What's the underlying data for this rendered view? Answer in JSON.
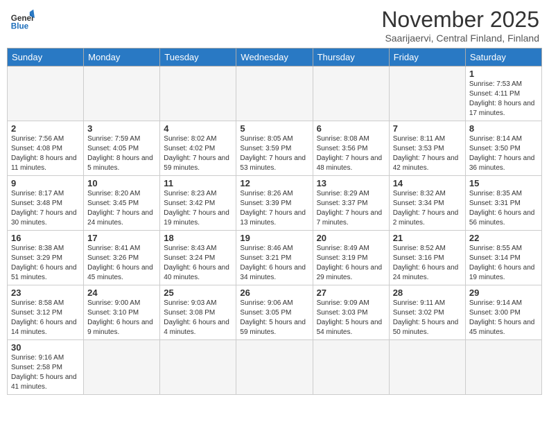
{
  "header": {
    "logo_general": "General",
    "logo_blue": "Blue",
    "month_title": "November 2025",
    "subtitle": "Saarijaervi, Central Finland, Finland"
  },
  "weekdays": [
    "Sunday",
    "Monday",
    "Tuesday",
    "Wednesday",
    "Thursday",
    "Friday",
    "Saturday"
  ],
  "weeks": [
    [
      {
        "day": "",
        "info": "",
        "empty": true
      },
      {
        "day": "",
        "info": "",
        "empty": true
      },
      {
        "day": "",
        "info": "",
        "empty": true
      },
      {
        "day": "",
        "info": "",
        "empty": true
      },
      {
        "day": "",
        "info": "",
        "empty": true
      },
      {
        "day": "",
        "info": "",
        "empty": true
      },
      {
        "day": "1",
        "info": "Sunrise: 7:53 AM\nSunset: 4:11 PM\nDaylight: 8 hours\nand 17 minutes."
      }
    ],
    [
      {
        "day": "2",
        "info": "Sunrise: 7:56 AM\nSunset: 4:08 PM\nDaylight: 8 hours\nand 11 minutes."
      },
      {
        "day": "3",
        "info": "Sunrise: 7:59 AM\nSunset: 4:05 PM\nDaylight: 8 hours\nand 5 minutes."
      },
      {
        "day": "4",
        "info": "Sunrise: 8:02 AM\nSunset: 4:02 PM\nDaylight: 7 hours\nand 59 minutes."
      },
      {
        "day": "5",
        "info": "Sunrise: 8:05 AM\nSunset: 3:59 PM\nDaylight: 7 hours\nand 53 minutes."
      },
      {
        "day": "6",
        "info": "Sunrise: 8:08 AM\nSunset: 3:56 PM\nDaylight: 7 hours\nand 48 minutes."
      },
      {
        "day": "7",
        "info": "Sunrise: 8:11 AM\nSunset: 3:53 PM\nDaylight: 7 hours\nand 42 minutes."
      },
      {
        "day": "8",
        "info": "Sunrise: 8:14 AM\nSunset: 3:50 PM\nDaylight: 7 hours\nand 36 minutes."
      }
    ],
    [
      {
        "day": "9",
        "info": "Sunrise: 8:17 AM\nSunset: 3:48 PM\nDaylight: 7 hours\nand 30 minutes."
      },
      {
        "day": "10",
        "info": "Sunrise: 8:20 AM\nSunset: 3:45 PM\nDaylight: 7 hours\nand 24 minutes."
      },
      {
        "day": "11",
        "info": "Sunrise: 8:23 AM\nSunset: 3:42 PM\nDaylight: 7 hours\nand 19 minutes."
      },
      {
        "day": "12",
        "info": "Sunrise: 8:26 AM\nSunset: 3:39 PM\nDaylight: 7 hours\nand 13 minutes."
      },
      {
        "day": "13",
        "info": "Sunrise: 8:29 AM\nSunset: 3:37 PM\nDaylight: 7 hours\nand 7 minutes."
      },
      {
        "day": "14",
        "info": "Sunrise: 8:32 AM\nSunset: 3:34 PM\nDaylight: 7 hours\nand 2 minutes."
      },
      {
        "day": "15",
        "info": "Sunrise: 8:35 AM\nSunset: 3:31 PM\nDaylight: 6 hours\nand 56 minutes."
      }
    ],
    [
      {
        "day": "16",
        "info": "Sunrise: 8:38 AM\nSunset: 3:29 PM\nDaylight: 6 hours\nand 51 minutes."
      },
      {
        "day": "17",
        "info": "Sunrise: 8:41 AM\nSunset: 3:26 PM\nDaylight: 6 hours\nand 45 minutes."
      },
      {
        "day": "18",
        "info": "Sunrise: 8:43 AM\nSunset: 3:24 PM\nDaylight: 6 hours\nand 40 minutes."
      },
      {
        "day": "19",
        "info": "Sunrise: 8:46 AM\nSunset: 3:21 PM\nDaylight: 6 hours\nand 34 minutes."
      },
      {
        "day": "20",
        "info": "Sunrise: 8:49 AM\nSunset: 3:19 PM\nDaylight: 6 hours\nand 29 minutes."
      },
      {
        "day": "21",
        "info": "Sunrise: 8:52 AM\nSunset: 3:16 PM\nDaylight: 6 hours\nand 24 minutes."
      },
      {
        "day": "22",
        "info": "Sunrise: 8:55 AM\nSunset: 3:14 PM\nDaylight: 6 hours\nand 19 minutes."
      }
    ],
    [
      {
        "day": "23",
        "info": "Sunrise: 8:58 AM\nSunset: 3:12 PM\nDaylight: 6 hours\nand 14 minutes."
      },
      {
        "day": "24",
        "info": "Sunrise: 9:00 AM\nSunset: 3:10 PM\nDaylight: 6 hours\nand 9 minutes."
      },
      {
        "day": "25",
        "info": "Sunrise: 9:03 AM\nSunset: 3:08 PM\nDaylight: 6 hours\nand 4 minutes."
      },
      {
        "day": "26",
        "info": "Sunrise: 9:06 AM\nSunset: 3:05 PM\nDaylight: 5 hours\nand 59 minutes."
      },
      {
        "day": "27",
        "info": "Sunrise: 9:09 AM\nSunset: 3:03 PM\nDaylight: 5 hours\nand 54 minutes."
      },
      {
        "day": "28",
        "info": "Sunrise: 9:11 AM\nSunset: 3:02 PM\nDaylight: 5 hours\nand 50 minutes."
      },
      {
        "day": "29",
        "info": "Sunrise: 9:14 AM\nSunset: 3:00 PM\nDaylight: 5 hours\nand 45 minutes."
      }
    ],
    [
      {
        "day": "30",
        "info": "Sunrise: 9:16 AM\nSunset: 2:58 PM\nDaylight: 5 hours\nand 41 minutes.",
        "last": true
      },
      {
        "day": "",
        "info": "",
        "empty": true,
        "last": true
      },
      {
        "day": "",
        "info": "",
        "empty": true,
        "last": true
      },
      {
        "day": "",
        "info": "",
        "empty": true,
        "last": true
      },
      {
        "day": "",
        "info": "",
        "empty": true,
        "last": true
      },
      {
        "day": "",
        "info": "",
        "empty": true,
        "last": true
      },
      {
        "day": "",
        "info": "",
        "empty": true,
        "last": true
      }
    ]
  ]
}
